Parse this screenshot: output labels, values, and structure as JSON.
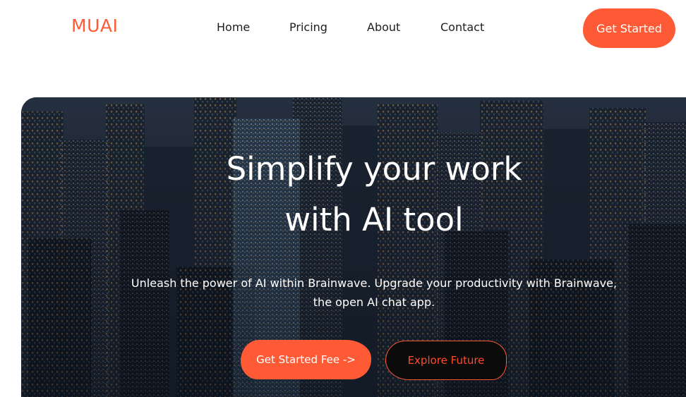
{
  "header": {
    "logo": "MUAI",
    "nav": [
      "Home",
      "Pricing",
      "About",
      "Contact"
    ],
    "cta_label": "Get Started"
  },
  "hero": {
    "title_line1": "Simplify your work",
    "title_line2": "with AI tool",
    "subtitle_line1": "Unleash the power of AI within Brainwave. Upgrade your productivity with Brainwave,",
    "subtitle_line2": "the open AI chat app.",
    "primary_button": "Get Started Fee ->",
    "secondary_button": "Explore Future"
  },
  "colors": {
    "accent": "#ff5a36",
    "text_dark": "#1e1e1e",
    "button_dark": "#0b0b0b"
  }
}
